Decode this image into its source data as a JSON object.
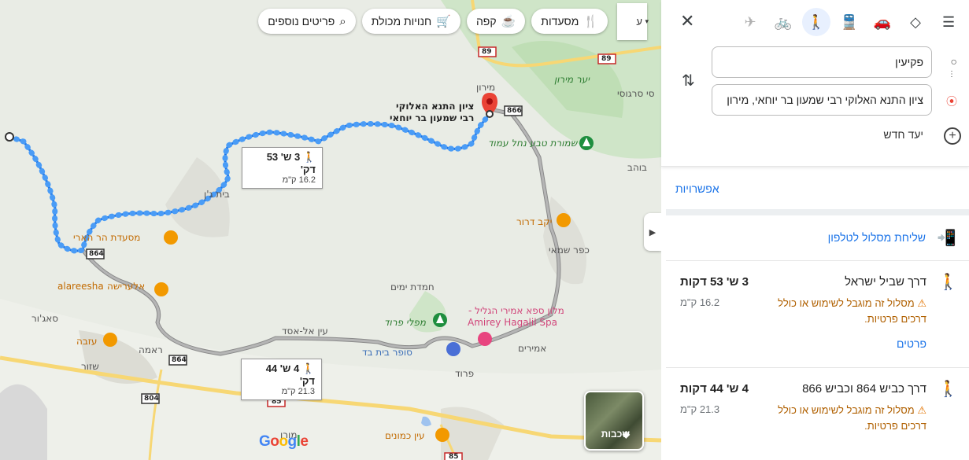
{
  "map": {
    "category_pills": [
      {
        "label": "מסעדות",
        "icon": "utensils-icon",
        "glyph": "🍴"
      },
      {
        "label": "קפה",
        "icon": "coffee-icon",
        "glyph": "☕"
      },
      {
        "label": "חנויות מכולת",
        "icon": "cart-icon",
        "glyph": "🛒"
      },
      {
        "label": "פריטים נוספים",
        "icon": "search-icon",
        "glyph": "⌕"
      }
    ],
    "pill_more_label": "ע",
    "places": {
      "destination": "ציון התנא האלוקי\nרבי שמעון בר יוחאי",
      "miron": "מירון",
      "yaar_miron": "יער מירון",
      "sasa": "סי סרגוסי",
      "shmurat": "שמורת טבע נחל עמוד",
      "beit_jann": "בית ג'ן",
      "mis_har_haari": "מסעדת הר הארי",
      "yekev_dror": "יקב דרור",
      "kfar_shamai": "כפר שמאי",
      "hemdat_yamim": "חמדת ימים",
      "hotel": "מלון ספא אמירי הגליל -",
      "hotel_en": "Amirey Hagalil Spa",
      "mapalei_parod": "מפלי פרוד",
      "ein_al_asad": "עין אל-אסד",
      "super_parod": "סופר בית בד",
      "amirim": "אמירים",
      "parod": "פרוד",
      "alareesha": "alareesha",
      "alareesha_he": "אלערישה",
      "sajur": "סאג'ור",
      "azba": "עזבה",
      "rama": "ראמה",
      "shezor": "שזור",
      "ein_kamonim": "עין כמונים",
      "moran": "מורן",
      "dovev": "בוהב"
    },
    "roads": [
      "89",
      "89",
      "866",
      "864",
      "864",
      "804",
      "85",
      "85"
    ],
    "route_boxes": [
      {
        "time": "3 ש' 53 דק'",
        "dist": "16.2 ק\"מ"
      },
      {
        "time": "4 ש' 44 דק'",
        "dist": "21.3 ק\"מ"
      }
    ],
    "layers_label": "שכבות",
    "google_logo": "Google"
  },
  "panel": {
    "modes": [
      {
        "name": "best-route-icon",
        "glyph": "◇"
      },
      {
        "name": "car-icon",
        "glyph": "🚗"
      },
      {
        "name": "transit-icon",
        "glyph": "🚆"
      },
      {
        "name": "walk-icon",
        "glyph": "🚶"
      },
      {
        "name": "bicycle-icon",
        "glyph": "🚲"
      },
      {
        "name": "flight-icon",
        "glyph": "✈"
      }
    ],
    "origin_value": "פקיעין",
    "destination_value": "ציון התנא האלוקי רבי שמעון בר יוחאי, מירון",
    "add_destination": "יעד חדש",
    "options_label": "אפשרויות",
    "send_to_phone": "שליחת מסלול לטלפון",
    "routes": [
      {
        "name": "דרך שביל ישראל",
        "time": "3 ש' 53 דקות",
        "distance": "16.2 ק\"מ",
        "warning": "מסלול זה מוגבל לשימוש או כולל דרכים פרטיות.",
        "details": "פרטים"
      },
      {
        "name": "דרך כביש 864 וכביש 866",
        "time": "4 ש' 44 דקות",
        "distance": "21.3 ק\"מ",
        "warning": "מסלול זה מוגבל לשימוש או כולל דרכים פרטיות."
      }
    ]
  }
}
